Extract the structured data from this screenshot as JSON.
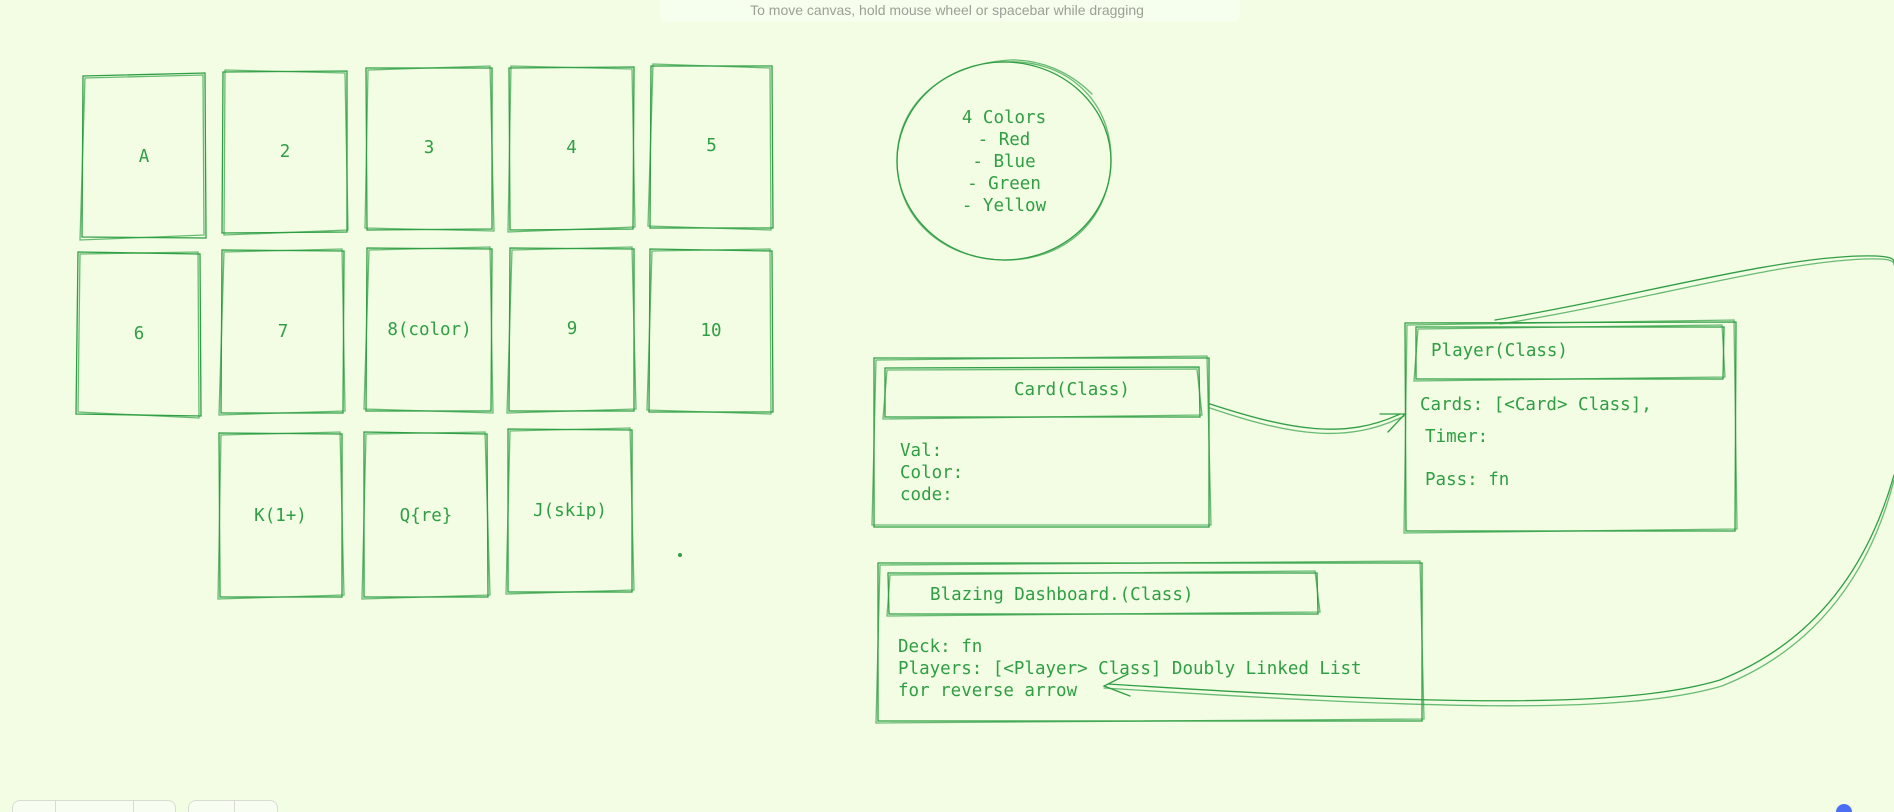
{
  "hint": "To move canvas, hold mouse wheel or spacebar while dragging",
  "cards": {
    "row1": [
      "A",
      "2",
      "3",
      "4",
      "5"
    ],
    "row2": [
      "6",
      "7",
      "8(color)",
      "9",
      "10"
    ],
    "row3": [
      "K(1+)",
      "Q{re}",
      "J(skip)"
    ]
  },
  "colors": {
    "title": "4 Colors",
    "items": [
      "- Red",
      "- Blue",
      "- Green",
      "- Yellow"
    ]
  },
  "card_class": {
    "title": "Card(Class)",
    "fields": [
      "Val:",
      "Color:",
      "code:"
    ]
  },
  "player_class": {
    "title": "Player(Class)",
    "fields": [
      "Cards: [<Card> Class],",
      "Timer:",
      "Pass: fn"
    ]
  },
  "dashboard_class": {
    "title": "Blazing Dashboard.(Class)",
    "fields": [
      "Deck: fn",
      "Players: [<Player> Class] Doubly Linked List",
      "for reverse arrow"
    ]
  },
  "colors_theme": {
    "background": "#f2fde3",
    "stroke": "#2f9e44",
    "hint_text": "#9ca096",
    "help_button": "#4c6ef5"
  }
}
